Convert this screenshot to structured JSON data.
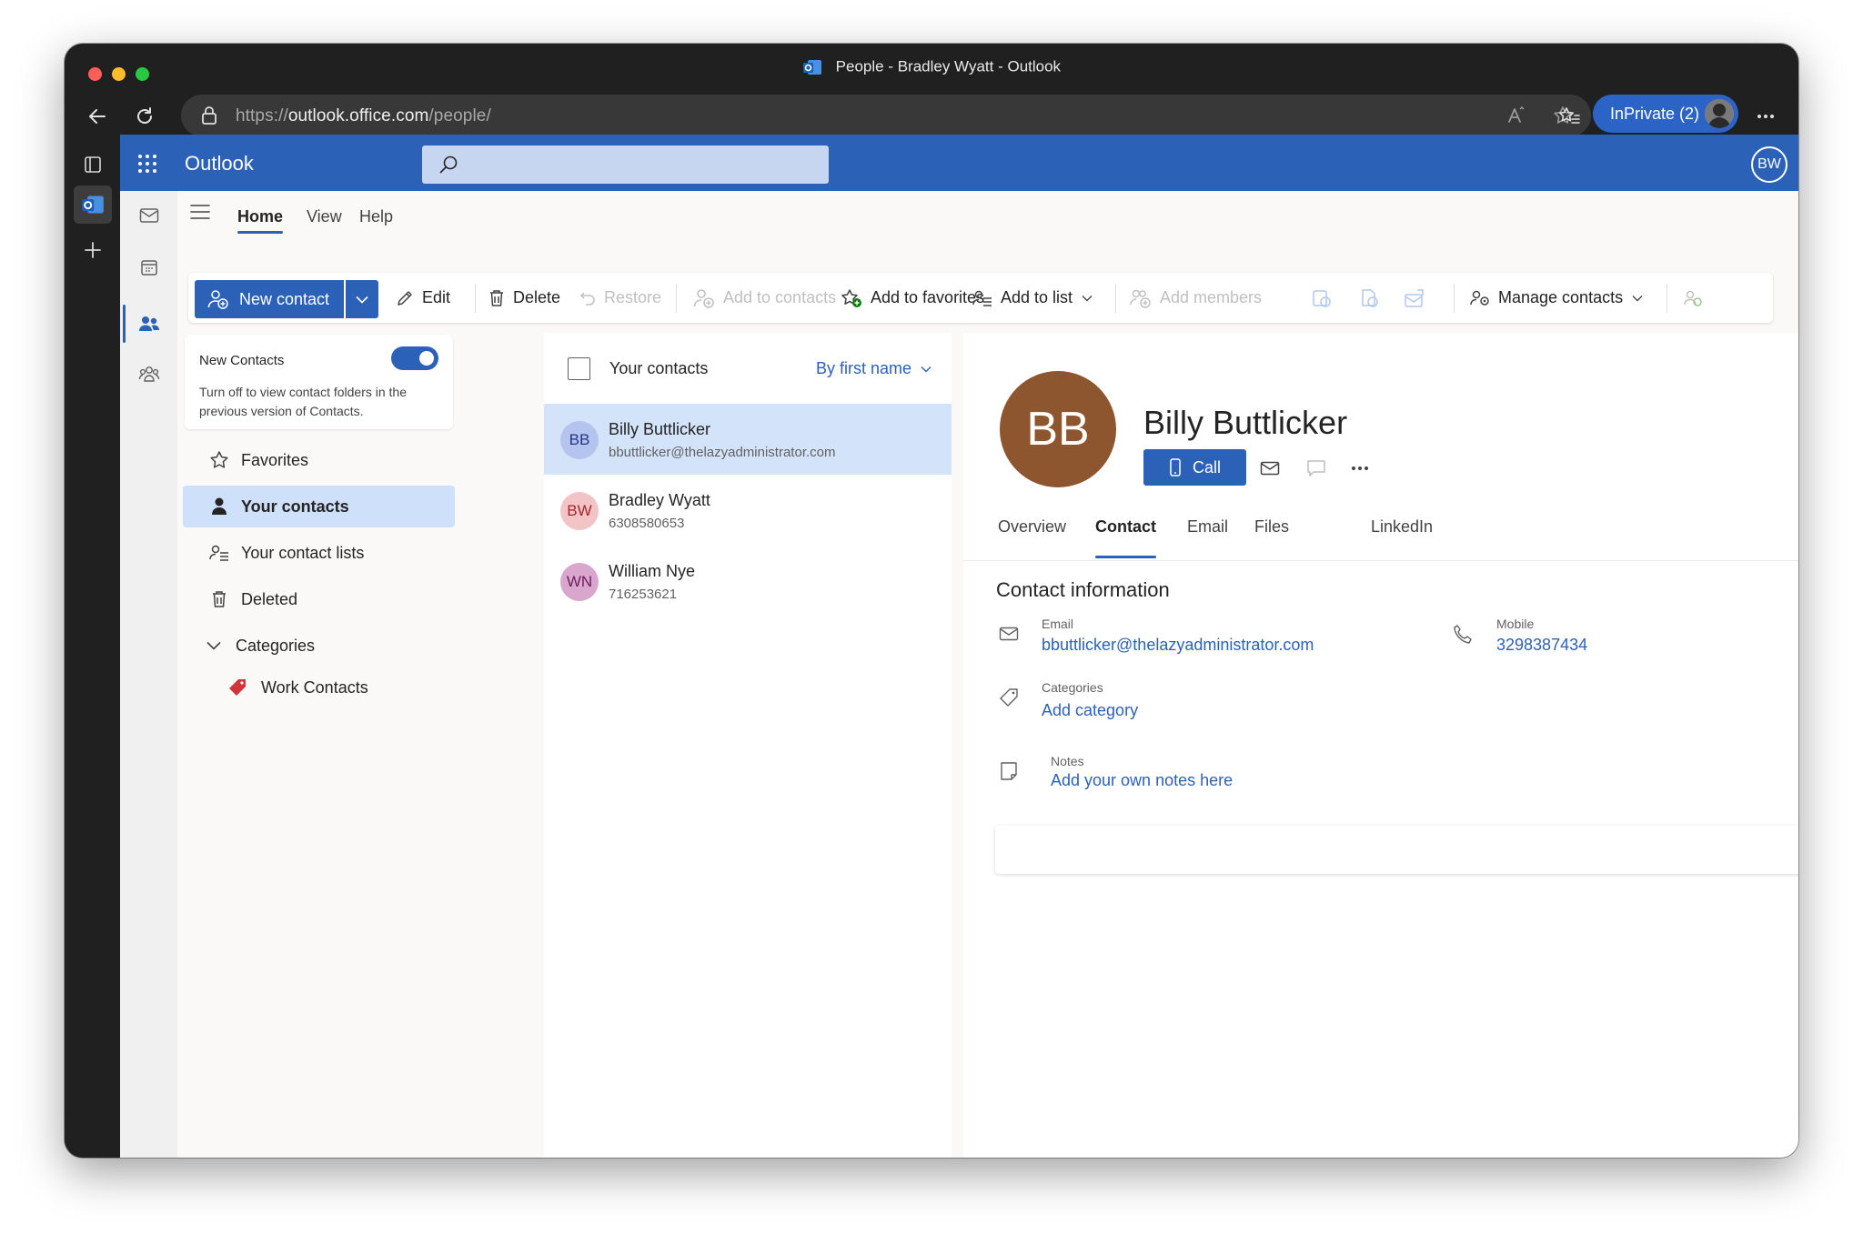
{
  "window": {
    "title": "People - Bradley Wyatt - Outlook"
  },
  "browser": {
    "url_scheme": "https://",
    "url_host": "outlook.office.com",
    "url_path": "/people/",
    "inprivate_label": "InPrivate (2)"
  },
  "app": {
    "title": "Outlook",
    "user_initials": "BW",
    "brand_color": "#2b62b8"
  },
  "tabs": [
    {
      "label": "Home"
    },
    {
      "label": "View"
    },
    {
      "label": "Help"
    }
  ],
  "ribbon": {
    "new_contact": "New contact",
    "edit": "Edit",
    "delete": "Delete",
    "restore": "Restore",
    "add_to_contacts": "Add to contacts",
    "add_to_favorites": "Add to favorites",
    "add_to_list": "Add to list",
    "add_members": "Add members",
    "manage_contacts": "Manage contacts"
  },
  "folders": {
    "toggle_title": "New Contacts",
    "toggle_desc": "Turn off to view contact folders in the previous version of Contacts.",
    "items": [
      {
        "label": "Favorites",
        "icon": "star-icon"
      },
      {
        "label": "Your contacts",
        "icon": "person-icon"
      },
      {
        "label": "Your contact lists",
        "icon": "people-list-icon"
      },
      {
        "label": "Deleted",
        "icon": "trash-icon"
      },
      {
        "label": "Categories",
        "icon": "chevron-down-icon"
      },
      {
        "label": "Work Contacts",
        "icon": "tag-icon"
      }
    ]
  },
  "contact_list": {
    "title": "Your contacts",
    "sort_label": "By first name",
    "contacts": [
      {
        "initials": "BB",
        "name": "Billy Buttlicker",
        "sub": "bbuttlicker@thelazyadministrator.com"
      },
      {
        "initials": "BW",
        "name": "Bradley Wyatt",
        "sub": "6308580653"
      },
      {
        "initials": "WN",
        "name": "William Nye",
        "sub": "716253621"
      }
    ]
  },
  "detail": {
    "initials": "BB",
    "name": "Billy Buttlicker",
    "call_label": "Call",
    "tabs": [
      {
        "label": "Overview"
      },
      {
        "label": "Contact"
      },
      {
        "label": "Email"
      },
      {
        "label": "Files"
      },
      {
        "label": "LinkedIn"
      }
    ],
    "section_title": "Contact information",
    "email_label": "Email",
    "email_value": "bbuttlicker@thelazyadministrator.com",
    "mobile_label": "Mobile",
    "mobile_value": "3298387434",
    "categories_label": "Categories",
    "categories_value": "Add category",
    "notes_label": "Notes",
    "notes_value": "Add your own notes here"
  }
}
